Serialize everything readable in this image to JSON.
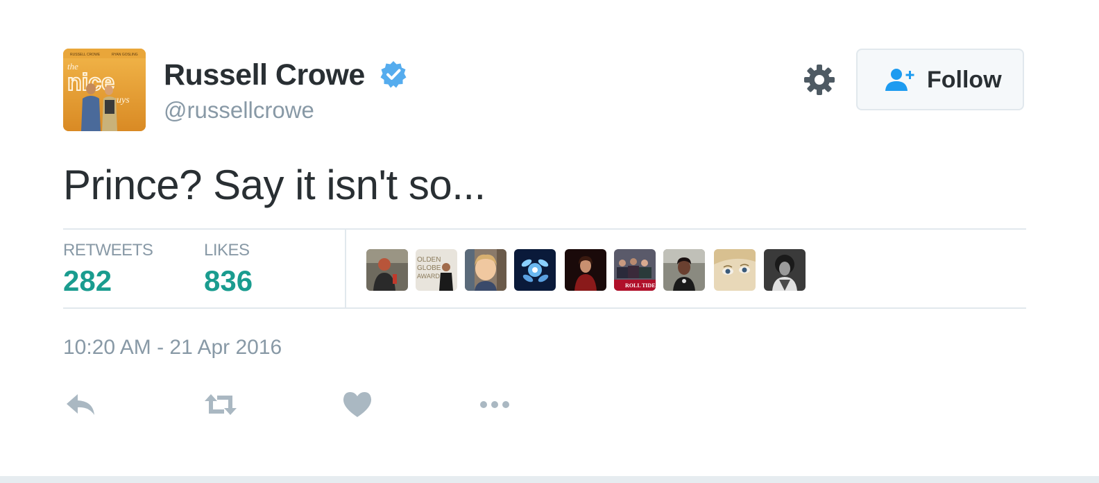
{
  "author": {
    "name": "Russell Crowe",
    "handle": "@russellcrowe",
    "verified": true,
    "avatar_icon": "movie-poster-avatar"
  },
  "header_actions": {
    "settings_icon": "gear-icon",
    "follow_label": "Follow",
    "follow_icon": "add-user-icon"
  },
  "tweet": {
    "text": "Prince? Say it isn't so..."
  },
  "stats": {
    "retweets_label": "RETWEETS",
    "retweets_count": "282",
    "likes_label": "LIKES",
    "likes_count": "836"
  },
  "likers_count_shown": 9,
  "timestamp": "10:20 AM - 21 Apr 2016",
  "actions": [
    "reply-icon",
    "retweet-icon",
    "like-icon",
    "more-icon"
  ],
  "colors": {
    "accent_teal": "#1a9c8f",
    "verified_blue": "#55acee",
    "muted_gray": "#8899a6",
    "icon_gray": "#aab8c2",
    "border": "#e1e8ed"
  }
}
